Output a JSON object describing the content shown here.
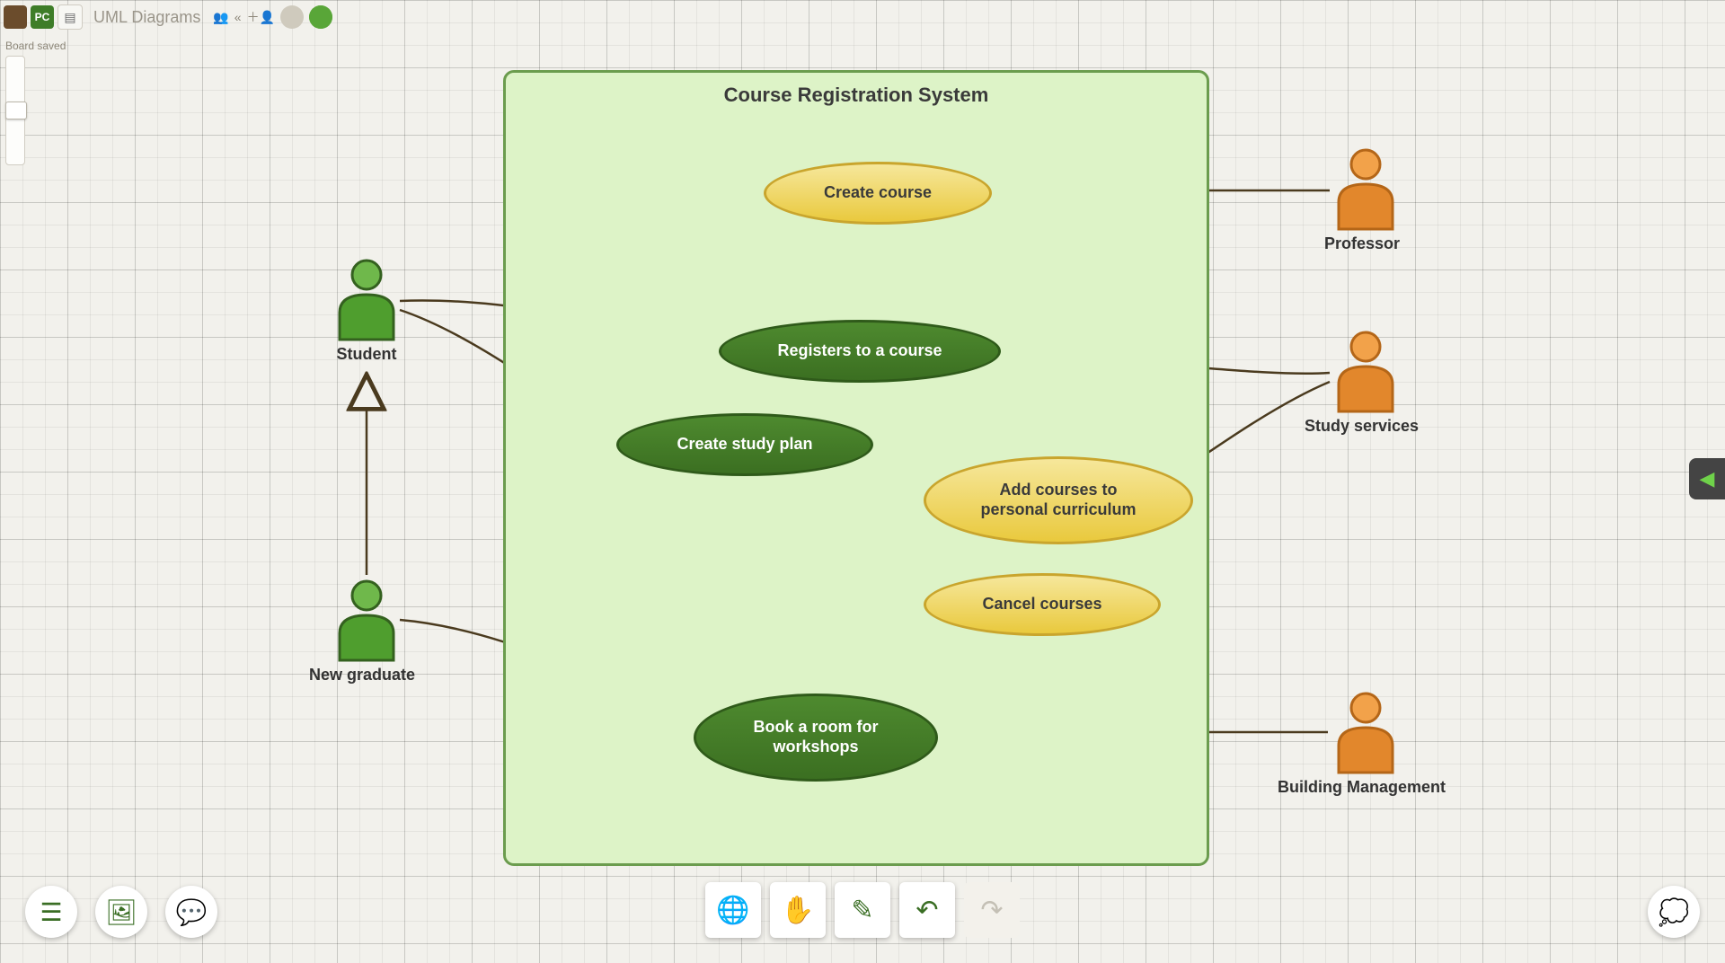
{
  "header": {
    "initials_main": "",
    "initials_pc": "PC",
    "title": "UML Diagrams",
    "saved": "Board saved"
  },
  "system": {
    "title": "Course Registration System"
  },
  "actors": {
    "student": "Student",
    "newgrad": "New graduate",
    "professor": "Professor",
    "study": "Study services",
    "building": "Building Management"
  },
  "usecases": {
    "create_course": "Create course",
    "registers": "Registers to a course",
    "study_plan": "Create study plan",
    "add_courses_l1": "Add courses to",
    "add_courses_l2": "personal curriculum",
    "cancel": "Cancel courses",
    "book_l1": "Book a room for",
    "book_l2": "workshops"
  },
  "colors": {
    "actor_green": "#4f9e2e",
    "actor_orange": "#e2872c",
    "uc_yellow": "#e9c93d",
    "uc_green": "#3b6f21"
  }
}
